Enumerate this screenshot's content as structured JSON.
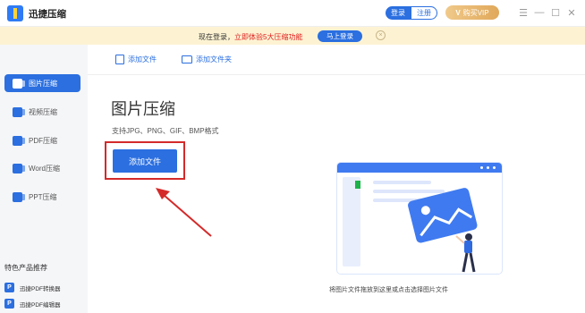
{
  "app": {
    "title": "迅捷压缩",
    "login_label": "登录",
    "register_label": "注册",
    "vip_label": "购买VIP",
    "vip_mark": "V",
    "window_controls": [
      "☰",
      "—",
      "☐",
      "✕"
    ]
  },
  "notice": {
    "prefix": "现在登录，",
    "highlight": "立即体验5大压缩功能",
    "button_label": "马上登录",
    "close_glyph": "×"
  },
  "sidebar": {
    "items": [
      {
        "label": "图片压缩",
        "active": true
      },
      {
        "label": "视频压缩",
        "active": false
      },
      {
        "label": "PDF压缩",
        "active": false
      },
      {
        "label": "Word压缩",
        "active": false
      },
      {
        "label": "PPT压缩",
        "active": false
      }
    ],
    "promo_title": "特色产品推荐",
    "promo_items": [
      {
        "label": "迅捷PDF转换器",
        "icon_letter": "P"
      },
      {
        "label": "迅捷PDF编辑器",
        "icon_letter": "P"
      }
    ]
  },
  "toolbar": {
    "add_file_label": "添加文件",
    "add_folder_label": "添加文件夹"
  },
  "main": {
    "title": "图片压缩",
    "formats": "支持JPG、PNG、GIF、BMP格式",
    "add_button_label": "添加文件",
    "drop_caption": "将图片文件拖放到这里或点击选择图片文件"
  },
  "colors": {
    "accent": "#2b6fe0",
    "notice_bg": "#fdf3d3",
    "highlight_red": "#d42a2a",
    "vip_gold": "#e0a85a"
  }
}
